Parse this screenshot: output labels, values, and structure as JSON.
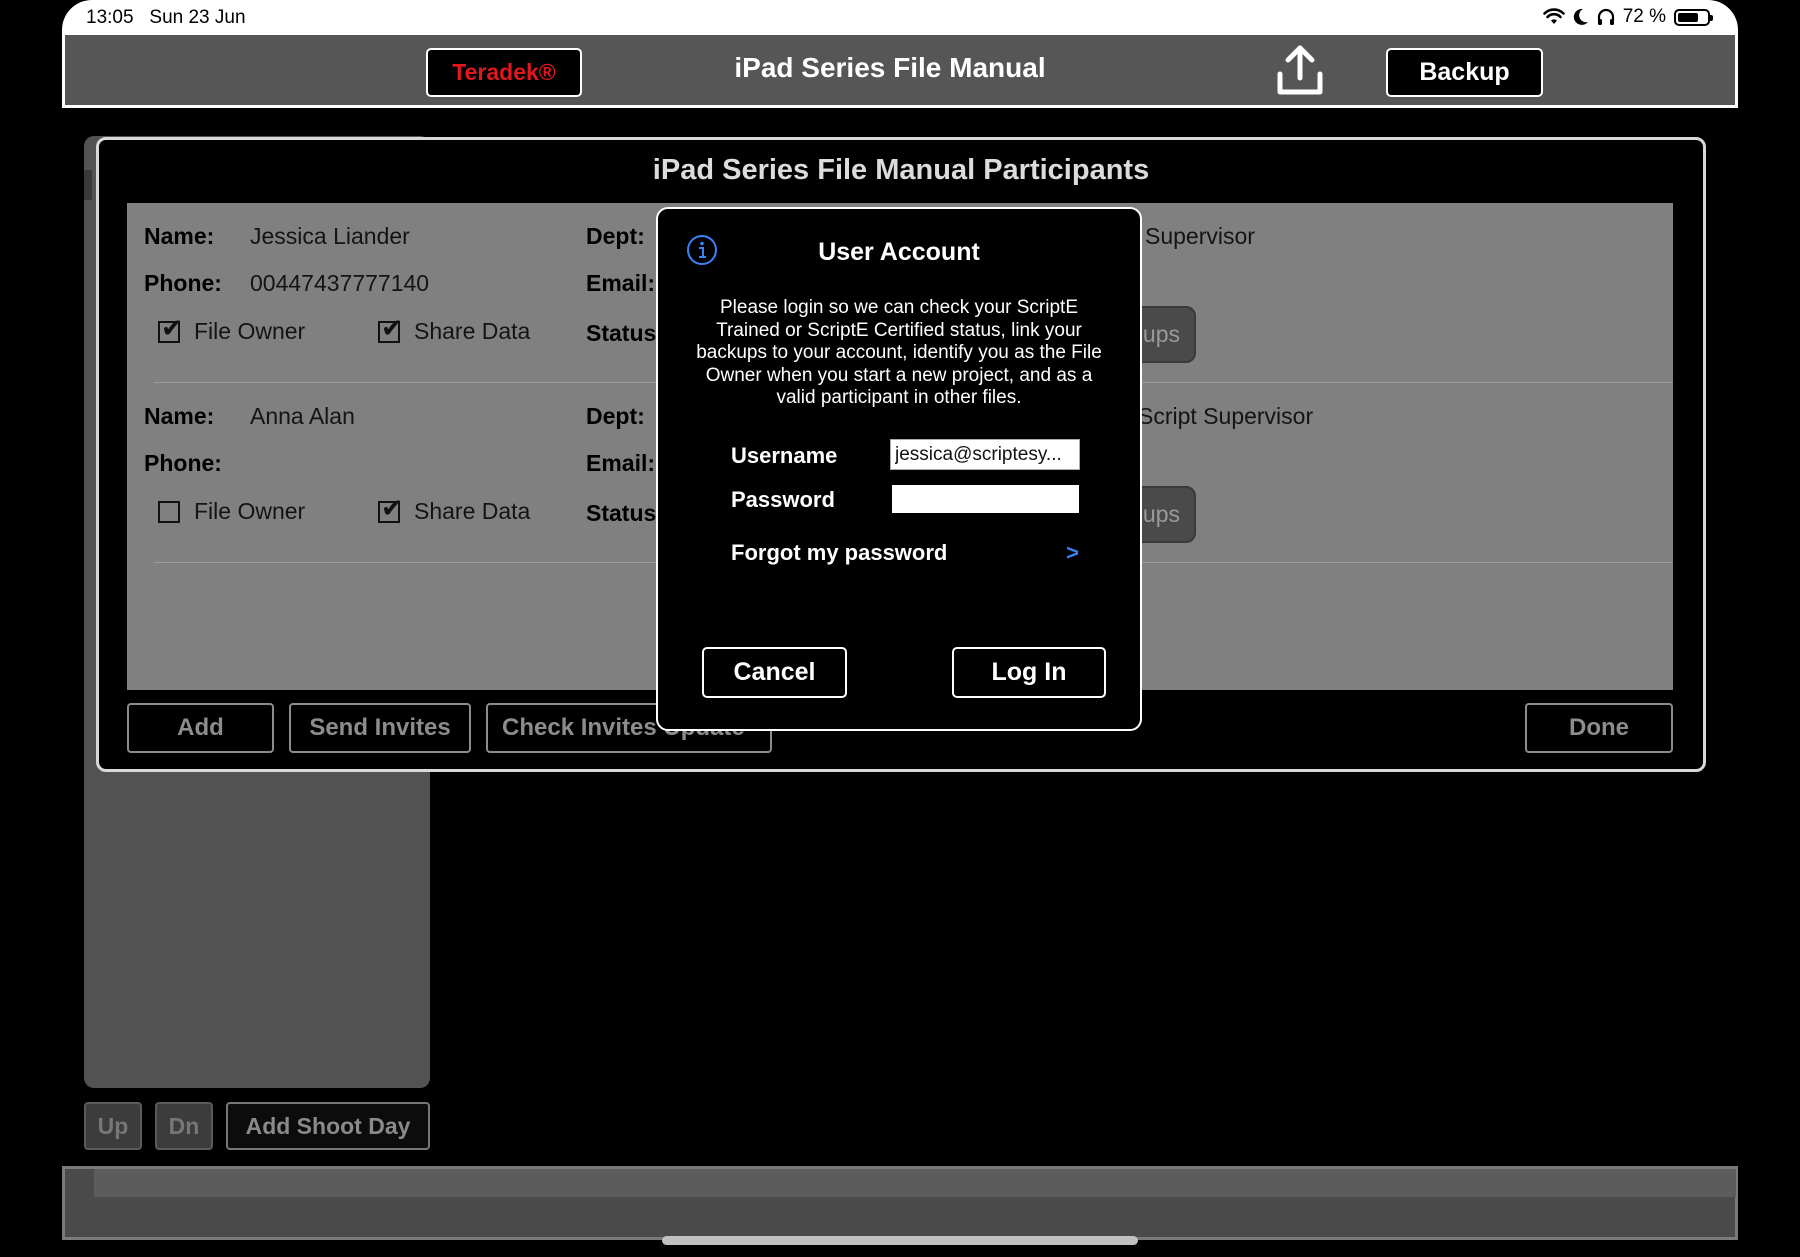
{
  "status_bar": {
    "time": "13:05",
    "date": "Sun 23 Jun",
    "battery_text": "72 %",
    "battery_level": 0.72
  },
  "toolbar": {
    "brand_button": "Teradek®",
    "title": "iPad Series File Manual",
    "backup_button": "Backup",
    "brand_color": "#e0171c"
  },
  "participants": {
    "title": "iPad Series File Manual Participants",
    "labels": {
      "name": "Name:",
      "phone": "Phone:",
      "dept": "Dept:",
      "email": "Email:",
      "status": "Status",
      "file_owner": "File Owner",
      "share_data": "Share Data"
    },
    "rows": [
      {
        "name": "Jessica Liander",
        "phone": "00447437777140",
        "dept_role": "Supervisor",
        "group_button": "ups",
        "file_owner": true,
        "share_data": true
      },
      {
        "name": "Anna Alan",
        "phone": "",
        "dept_role": "Script Supervisor",
        "group_button": "ups",
        "file_owner": false,
        "share_data": true
      }
    ],
    "buttons": {
      "add": "Add",
      "send_invites": "Send Invites",
      "check_invites": "Check Invites Update",
      "done": "Done"
    }
  },
  "background": {
    "up_button": "Up",
    "dn_button": "Dn",
    "add_shoot_day_button": "Add Shoot Day"
  },
  "modal": {
    "title": "User Account",
    "message": "Please login so we can check your ScriptE Trained or ScriptE Certified status, link your backups to your account, identify you as the File Owner when you start a new project, and as a valid participant in other files.",
    "username_label": "Username",
    "username_value": "jessica@scriptesy...",
    "password_label": "Password",
    "password_value": "",
    "forgot_label": "Forgot my password",
    "forgot_chevron": ">",
    "cancel_button": "Cancel",
    "login_button": "Log In",
    "info_icon": "info-circle-icon",
    "accent_color": "#3a82f7"
  }
}
